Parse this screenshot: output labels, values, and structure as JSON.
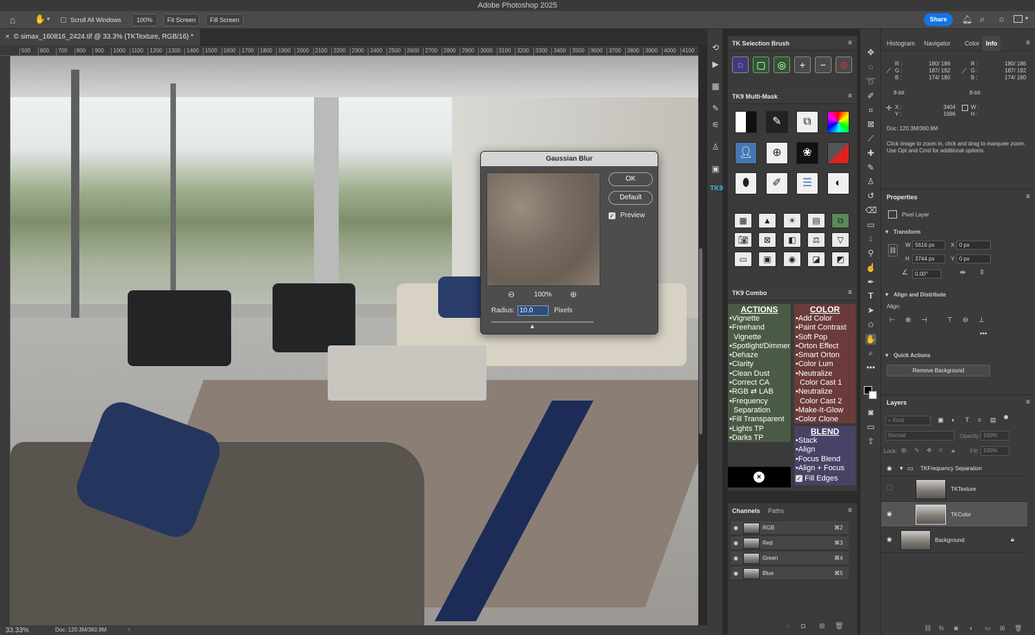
{
  "app": {
    "title": "Adobe Photoshop 2025"
  },
  "options_bar": {
    "scroll_all_windows": "Scroll All Windows",
    "zoom_btn": "100%",
    "fit_screen": "Fit Screen",
    "fill_screen": "Fill Screen",
    "share": "Share"
  },
  "document": {
    "tab_title": "© simax_160816_2424.tif @ 33.3% (TKTexture, RGB/16) *",
    "ruler_ticks": [
      "500",
      "600",
      "700",
      "800",
      "900",
      "1000",
      "1100",
      "1200",
      "1300",
      "1400",
      "1500",
      "1600",
      "1700",
      "1800",
      "1900",
      "2000",
      "2100",
      "2200",
      "2300",
      "2400",
      "2500",
      "2600",
      "2700",
      "2800",
      "2900",
      "3000",
      "3100",
      "3200",
      "3300",
      "3400",
      "3500",
      "3600",
      "3700",
      "3800",
      "3900",
      "4000",
      "4100"
    ],
    "zoom_level": "33.33%",
    "doc_size": "Doc: 120.3M/360.9M"
  },
  "gaussian_blur": {
    "title": "Gaussian Blur",
    "ok": "OK",
    "default": "Default",
    "preview_label": "Preview",
    "preview_checked": true,
    "zoom": "100%",
    "radius_label": "Radius:",
    "radius_value": "10.0",
    "units": "Pixels"
  },
  "tk_panel": {
    "selection_brush": "TK Selection Brush",
    "multi_mask": "TK9 Multi-Mask",
    "combo": "TK9 Combo",
    "actions_head": "ACTIONS",
    "actions": [
      "•Vignette",
      "•Freehand",
      "  Vignette",
      "•Spotlight/Dimmer",
      "•Dehaze",
      "•Clarity",
      "•Clean Dust",
      "•Correct CA",
      "•RGB ⇄ LAB",
      "•Frequency",
      "  Separation",
      "•Fill Transparent",
      "•Lights TP",
      "•Darks TP"
    ],
    "color_head": "COLOR",
    "color_items": [
      "•Add Color",
      "•Paint Contrast",
      "•Soft Pop",
      "•Orton Effect",
      "•Smart Orton",
      "•Color Lum",
      "•Neutralize",
      "  Color Cast 1",
      "•Neutralize",
      "  Color Cast 2",
      "•Make-It-Glow",
      "•Color Clone"
    ],
    "blend_head": "BLEND",
    "blend_items": [
      "•Stack",
      "•Align",
      "•Focus Blend",
      "•Align + Focus"
    ],
    "fill_edges": "Fill Edges"
  },
  "channels": {
    "tab_channels": "Channels",
    "tab_paths": "Paths",
    "rows": [
      {
        "name": "RGB",
        "shortcut": "⌘2"
      },
      {
        "name": "Red",
        "shortcut": "⌘3"
      },
      {
        "name": "Green",
        "shortcut": "⌘4"
      },
      {
        "name": "Blue",
        "shortcut": "⌘5"
      }
    ]
  },
  "info_panel": {
    "tabs": [
      "Histogram",
      "Navigator",
      "Color",
      "Info"
    ],
    "rgb_left": {
      "r": "180/ 186",
      "g": "187/ 192",
      "b": "174/ 180"
    },
    "rgb_right": {
      "r": "180/ 186",
      "g": "187/ 192",
      "b": "174/ 180"
    },
    "bit_left": "8-bit",
    "bit_right": "8-bit",
    "x": "3404",
    "y": "1696",
    "doc": "Doc: 120.3M/360.9M",
    "hint": "Click image to zoom in, click and drag to marquee zoom.  Use Opt and Cmd for additional options."
  },
  "properties": {
    "title": "Properties",
    "layer_type": "Pixel Layer",
    "transform": "Transform",
    "w": "5616 px",
    "h": "3744 px",
    "x": "0 px",
    "y": "0 px",
    "angle": "0.00°",
    "align_distribute": "Align and Distribute",
    "align_label": "Align:",
    "quick_actions": "Quick Actions",
    "remove_bg": "Remove Background"
  },
  "layers": {
    "title": "Layers",
    "kind": "Kind",
    "blend_mode": "Normal",
    "opacity_label": "Opacity:",
    "opacity": "100%",
    "lock_label": "Lock:",
    "fill_label": "Fill:",
    "fill": "100%",
    "group": "TKFrequency Separation",
    "items": [
      "TKTexture",
      "TKColor",
      "Background"
    ]
  },
  "colors": {
    "accent": "#1473e6",
    "actions_bg": "#4b5a44",
    "color_bg": "#6b3b3b",
    "blend_bg": "#4a4266"
  }
}
